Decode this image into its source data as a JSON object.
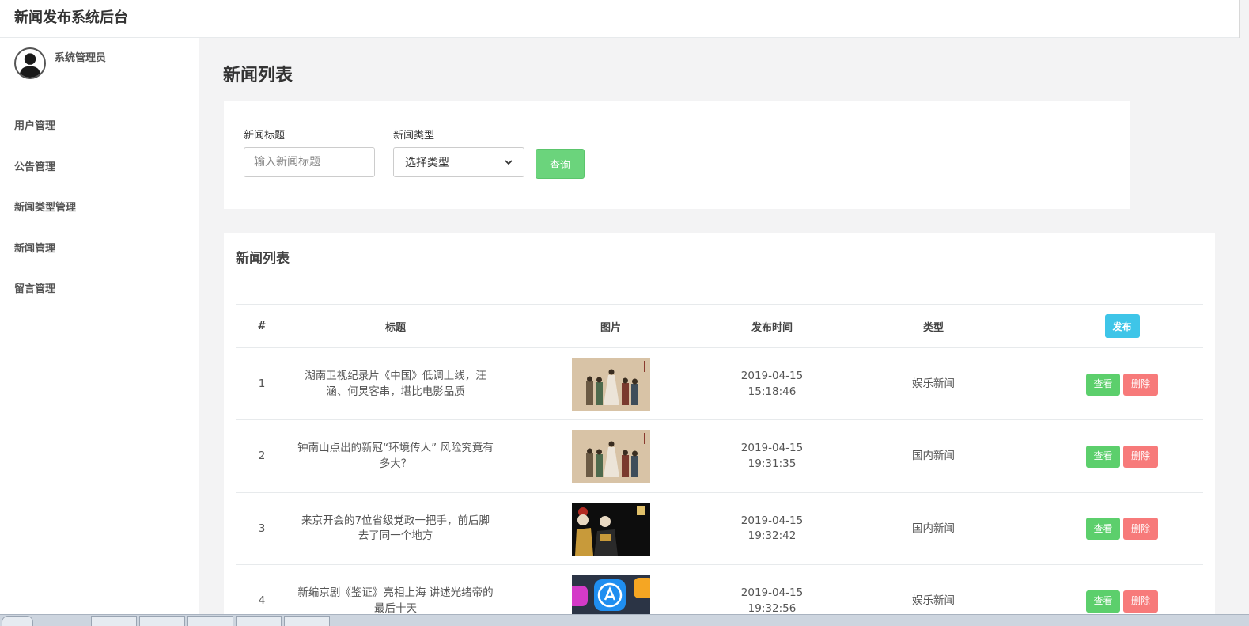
{
  "app": {
    "title": "新闻发布系统后台"
  },
  "user": {
    "name": "系统管理员"
  },
  "sidebar": {
    "items": [
      {
        "label": "用户管理"
      },
      {
        "label": "公告管理"
      },
      {
        "label": "新闻类型管理"
      },
      {
        "label": "新闻管理"
      },
      {
        "label": "留言管理"
      }
    ]
  },
  "page": {
    "title": "新闻列表"
  },
  "search": {
    "title_label": "新闻标题",
    "title_placeholder": "输入新闻标题",
    "title_value": "",
    "type_label": "新闻类型",
    "type_selected": "选择类型",
    "query_label": "查询"
  },
  "list": {
    "header": "新闻列表",
    "columns": [
      "#",
      "标题",
      "图片",
      "发布时间",
      "类型"
    ],
    "publish_label": "发布",
    "view_label": "查看",
    "delete_label": "删除",
    "rows": [
      {
        "id": "1",
        "title": "湖南卫视纪录片《中国》低调上线，汪涵、何炅客串，堪比电影品质",
        "date": "2019-04-15",
        "time": "15:18:46",
        "type": "娱乐新闻",
        "image": "painting-figures"
      },
      {
        "id": "2",
        "title": "钟南山点出的新冠“环境传人” 风险究竟有多大？",
        "date": "2019-04-15",
        "time": "19:31:35",
        "type": "国内新闻",
        "image": "painting-figures"
      },
      {
        "id": "3",
        "title": "来京开会的7位省级党政一把手，前后脚去了同一个地方",
        "date": "2019-04-15",
        "time": "19:32:42",
        "type": "国内新闻",
        "image": "drama-scene"
      },
      {
        "id": "4",
        "title": "新编京剧《鉴证》亮相上海 讲述光绪帝的最后十天",
        "date": "2019-04-15",
        "time": "19:32:56",
        "type": "娱乐新闻",
        "image": "app-icons"
      }
    ]
  },
  "colors": {
    "accent_green": "#6bd47c",
    "accent_cyan": "#3ec5e8",
    "accent_red": "#f77a7a",
    "background": "#f3f3f4"
  }
}
